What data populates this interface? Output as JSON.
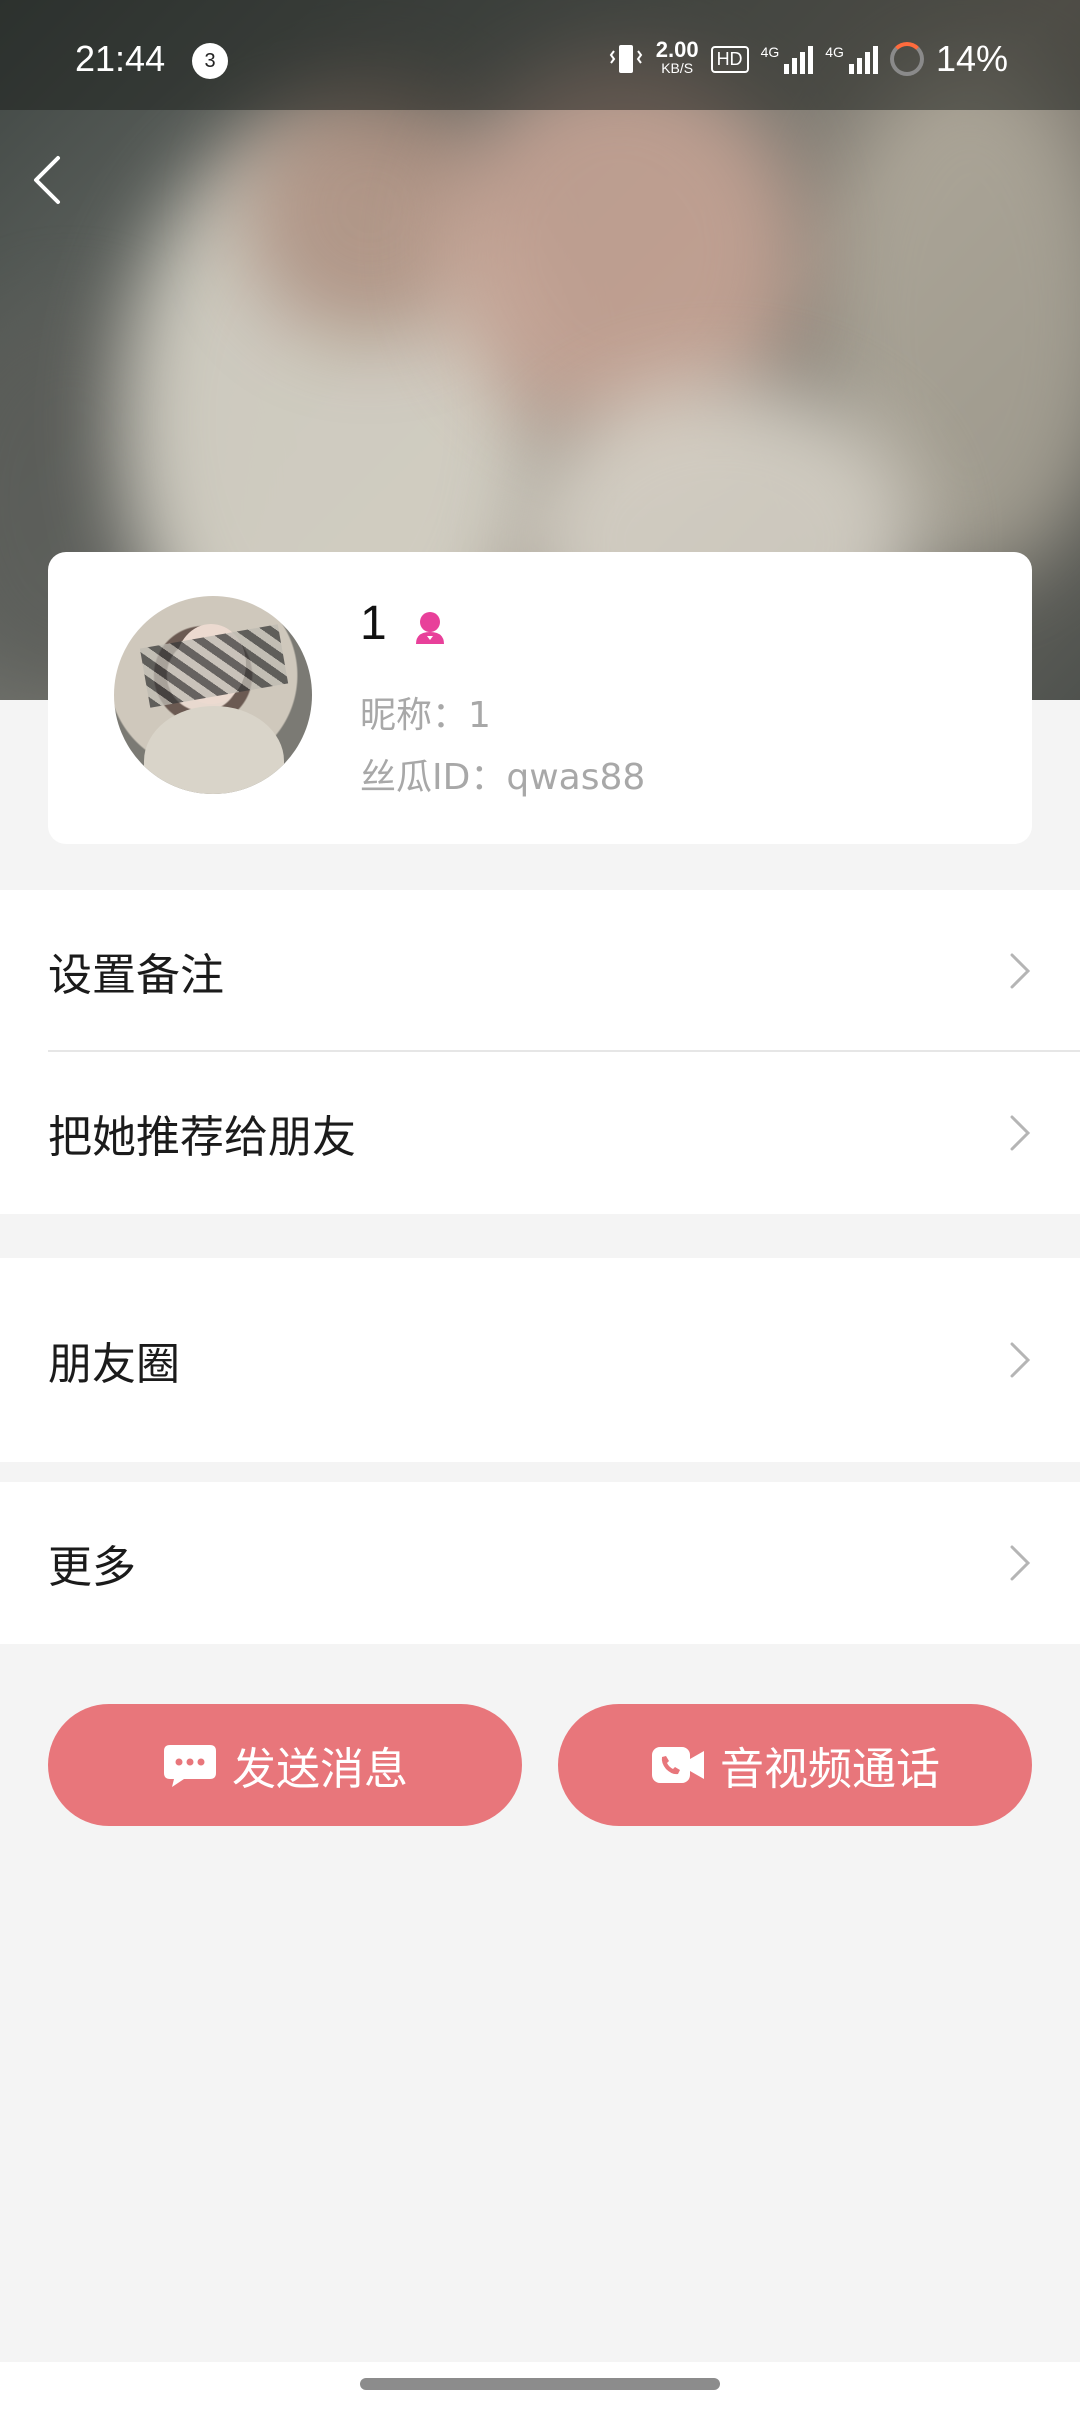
{
  "status_bar": {
    "time": "21:44",
    "notification_count": "3",
    "net_speed_value": "2.00",
    "net_speed_unit": "KB/S",
    "hd_label": "HD",
    "signal1_label": "4G",
    "signal2_label": "4G",
    "battery": "14%"
  },
  "profile": {
    "name": "1",
    "gender_icon": "female-icon",
    "gender_color": "#e8409a",
    "nickname": "昵称：1",
    "user_id": "丝瓜ID：qwas88"
  },
  "menu": {
    "remark": "设置备注",
    "recommend": "把她推荐给朋友",
    "moments": "朋友圈",
    "more": "更多"
  },
  "actions": {
    "send_message": "发送消息",
    "av_call": "音视频通话",
    "accent_color": "#e8767b"
  },
  "icons": {
    "back": "back-arrow-icon",
    "chevron": "chevron-right-icon",
    "message": "chat-bubble-icon",
    "call": "video-call-icon"
  }
}
